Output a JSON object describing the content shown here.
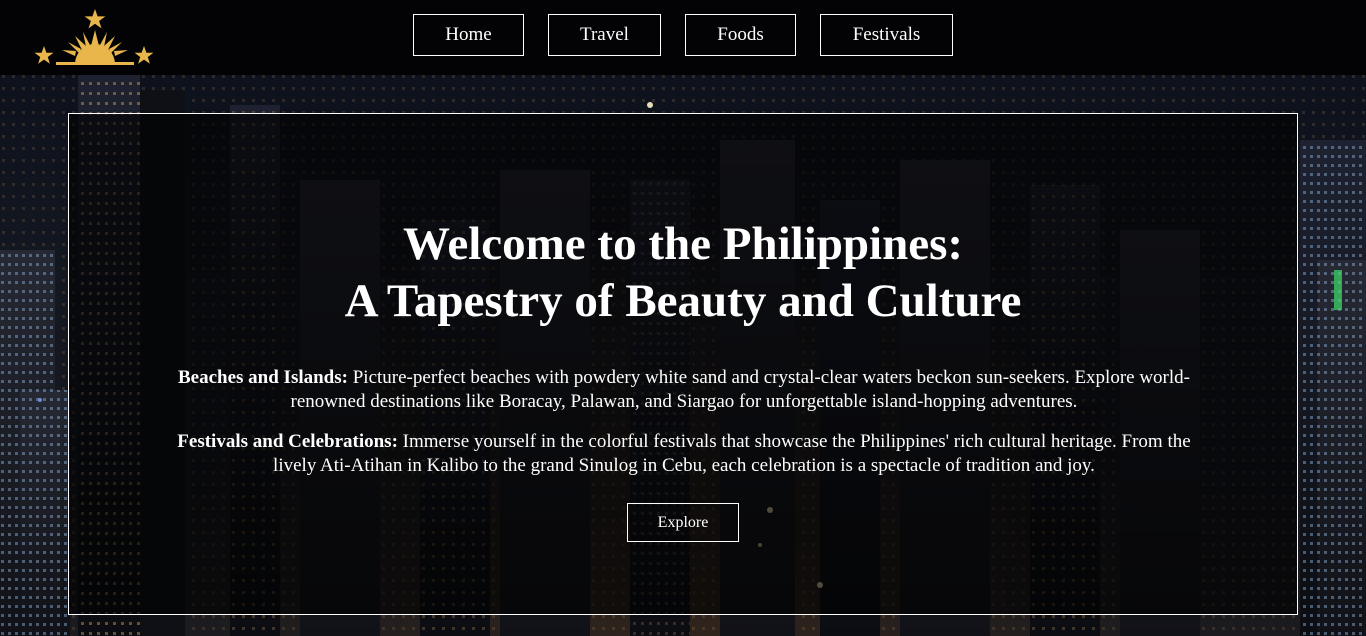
{
  "header": {
    "logo": "philippine-sun-and-stars-logo",
    "nav": [
      {
        "label": "Home"
      },
      {
        "label": "Travel"
      },
      {
        "label": "Foods"
      },
      {
        "label": "Festivals"
      }
    ]
  },
  "hero": {
    "title_line1": "Welcome to the Philippines:",
    "title_line2": "A Tapestry of Beauty and Culture",
    "sections": [
      {
        "heading": "Beaches and Islands:",
        "text": " Picture-perfect beaches with powdery white sand and crystal-clear waters beckon sun-seekers. Explore world-renowned destinations like Boracay, Palawan, and Siargao for unforgettable island-hopping adventures."
      },
      {
        "heading": "Festivals and Celebrations:",
        "text": " Immerse yourself in the colorful festivals that showcase the Philippines' rich cultural heritage. From the lively Ati-Atihan in Kalibo to the grand Sinulog in Cebu, each celebration is a spectacle of tradition and joy."
      }
    ],
    "button_label": "Explore"
  },
  "colors": {
    "header_bg": "#030305",
    "logo_gold": "#e8b64a",
    "text": "#ffffff",
    "border": "#ffffff"
  },
  "background": "night-city-skyline-photo"
}
